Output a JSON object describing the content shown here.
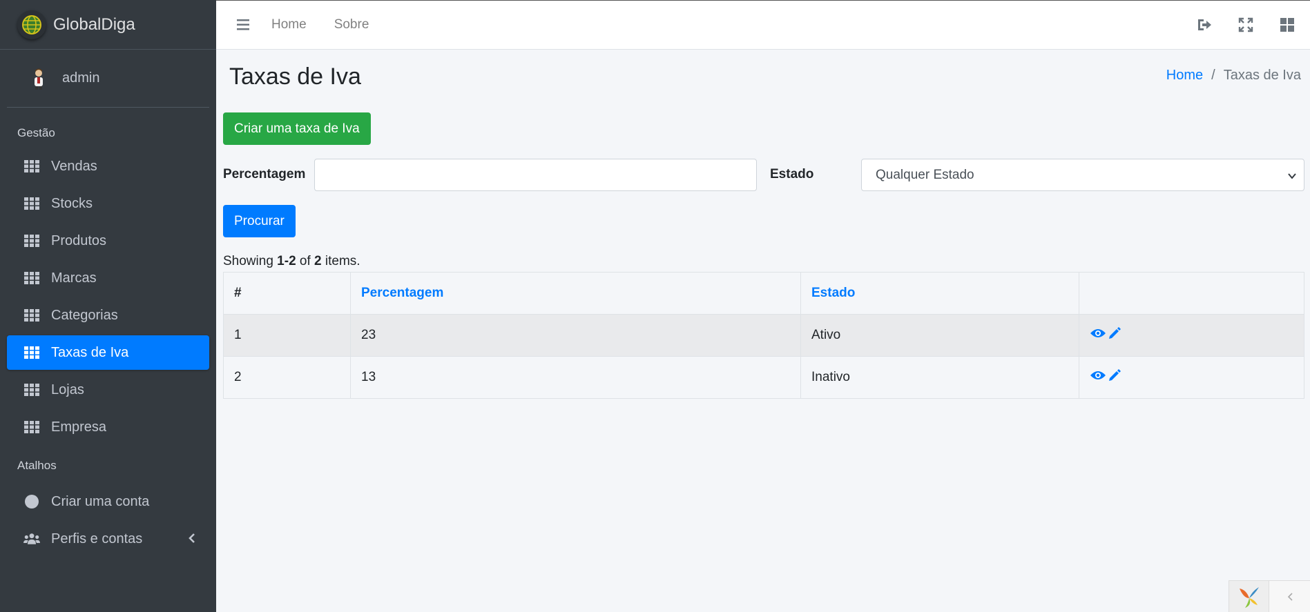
{
  "brand": {
    "name": "GlobalDiga",
    "logo_icon": "globe-icon"
  },
  "user": {
    "name": "admin",
    "avatar_icon": "user-avatar-icon"
  },
  "sidebar": {
    "header_gestao": "Gestão",
    "items": [
      {
        "label": "Vendas",
        "icon": "grid-icon"
      },
      {
        "label": "Stocks",
        "icon": "grid-icon"
      },
      {
        "label": "Produtos",
        "icon": "grid-icon"
      },
      {
        "label": "Marcas",
        "icon": "grid-icon"
      },
      {
        "label": "Categorias",
        "icon": "grid-icon"
      },
      {
        "label": "Taxas de Iva",
        "icon": "grid-icon",
        "active": true
      },
      {
        "label": "Lojas",
        "icon": "grid-icon"
      },
      {
        "label": "Empresa",
        "icon": "grid-icon"
      }
    ],
    "header_atalhos": "Atalhos",
    "shortcuts": [
      {
        "label": "Criar uma conta",
        "icon": "circle-icon"
      },
      {
        "label": "Perfis e contas",
        "icon": "users-icon"
      }
    ]
  },
  "topbar": {
    "links": [
      "Home",
      "Sobre"
    ],
    "right_icons": [
      "logout-icon",
      "fullscreen-icon",
      "grid-layout-icon"
    ]
  },
  "page": {
    "title": "Taxas de Iva",
    "breadcrumb": {
      "home": "Home",
      "separator": "/",
      "current": "Taxas de Iva"
    },
    "create_button": "Criar uma taxa de Iva",
    "filters": {
      "percentagem_label": "Percentagem",
      "percentagem_value": "",
      "estado_label": "Estado",
      "estado_selected": "Qualquer Estado"
    },
    "search_button": "Procurar",
    "summary": {
      "prefix": "Showing ",
      "range": "1-2",
      "mid": " of ",
      "total": "2",
      "suffix": " items."
    }
  },
  "table": {
    "headers": [
      "#",
      "Percentagem",
      "Estado",
      ""
    ],
    "rows": [
      {
        "num": "1",
        "percentagem": "23",
        "estado": "Ativo"
      },
      {
        "num": "2",
        "percentagem": "13",
        "estado": "Inativo"
      }
    ]
  },
  "colors": {
    "sidebar_bg": "#343a40",
    "primary": "#007bff",
    "success": "#28a745",
    "content_bg": "#f4f6f9"
  }
}
